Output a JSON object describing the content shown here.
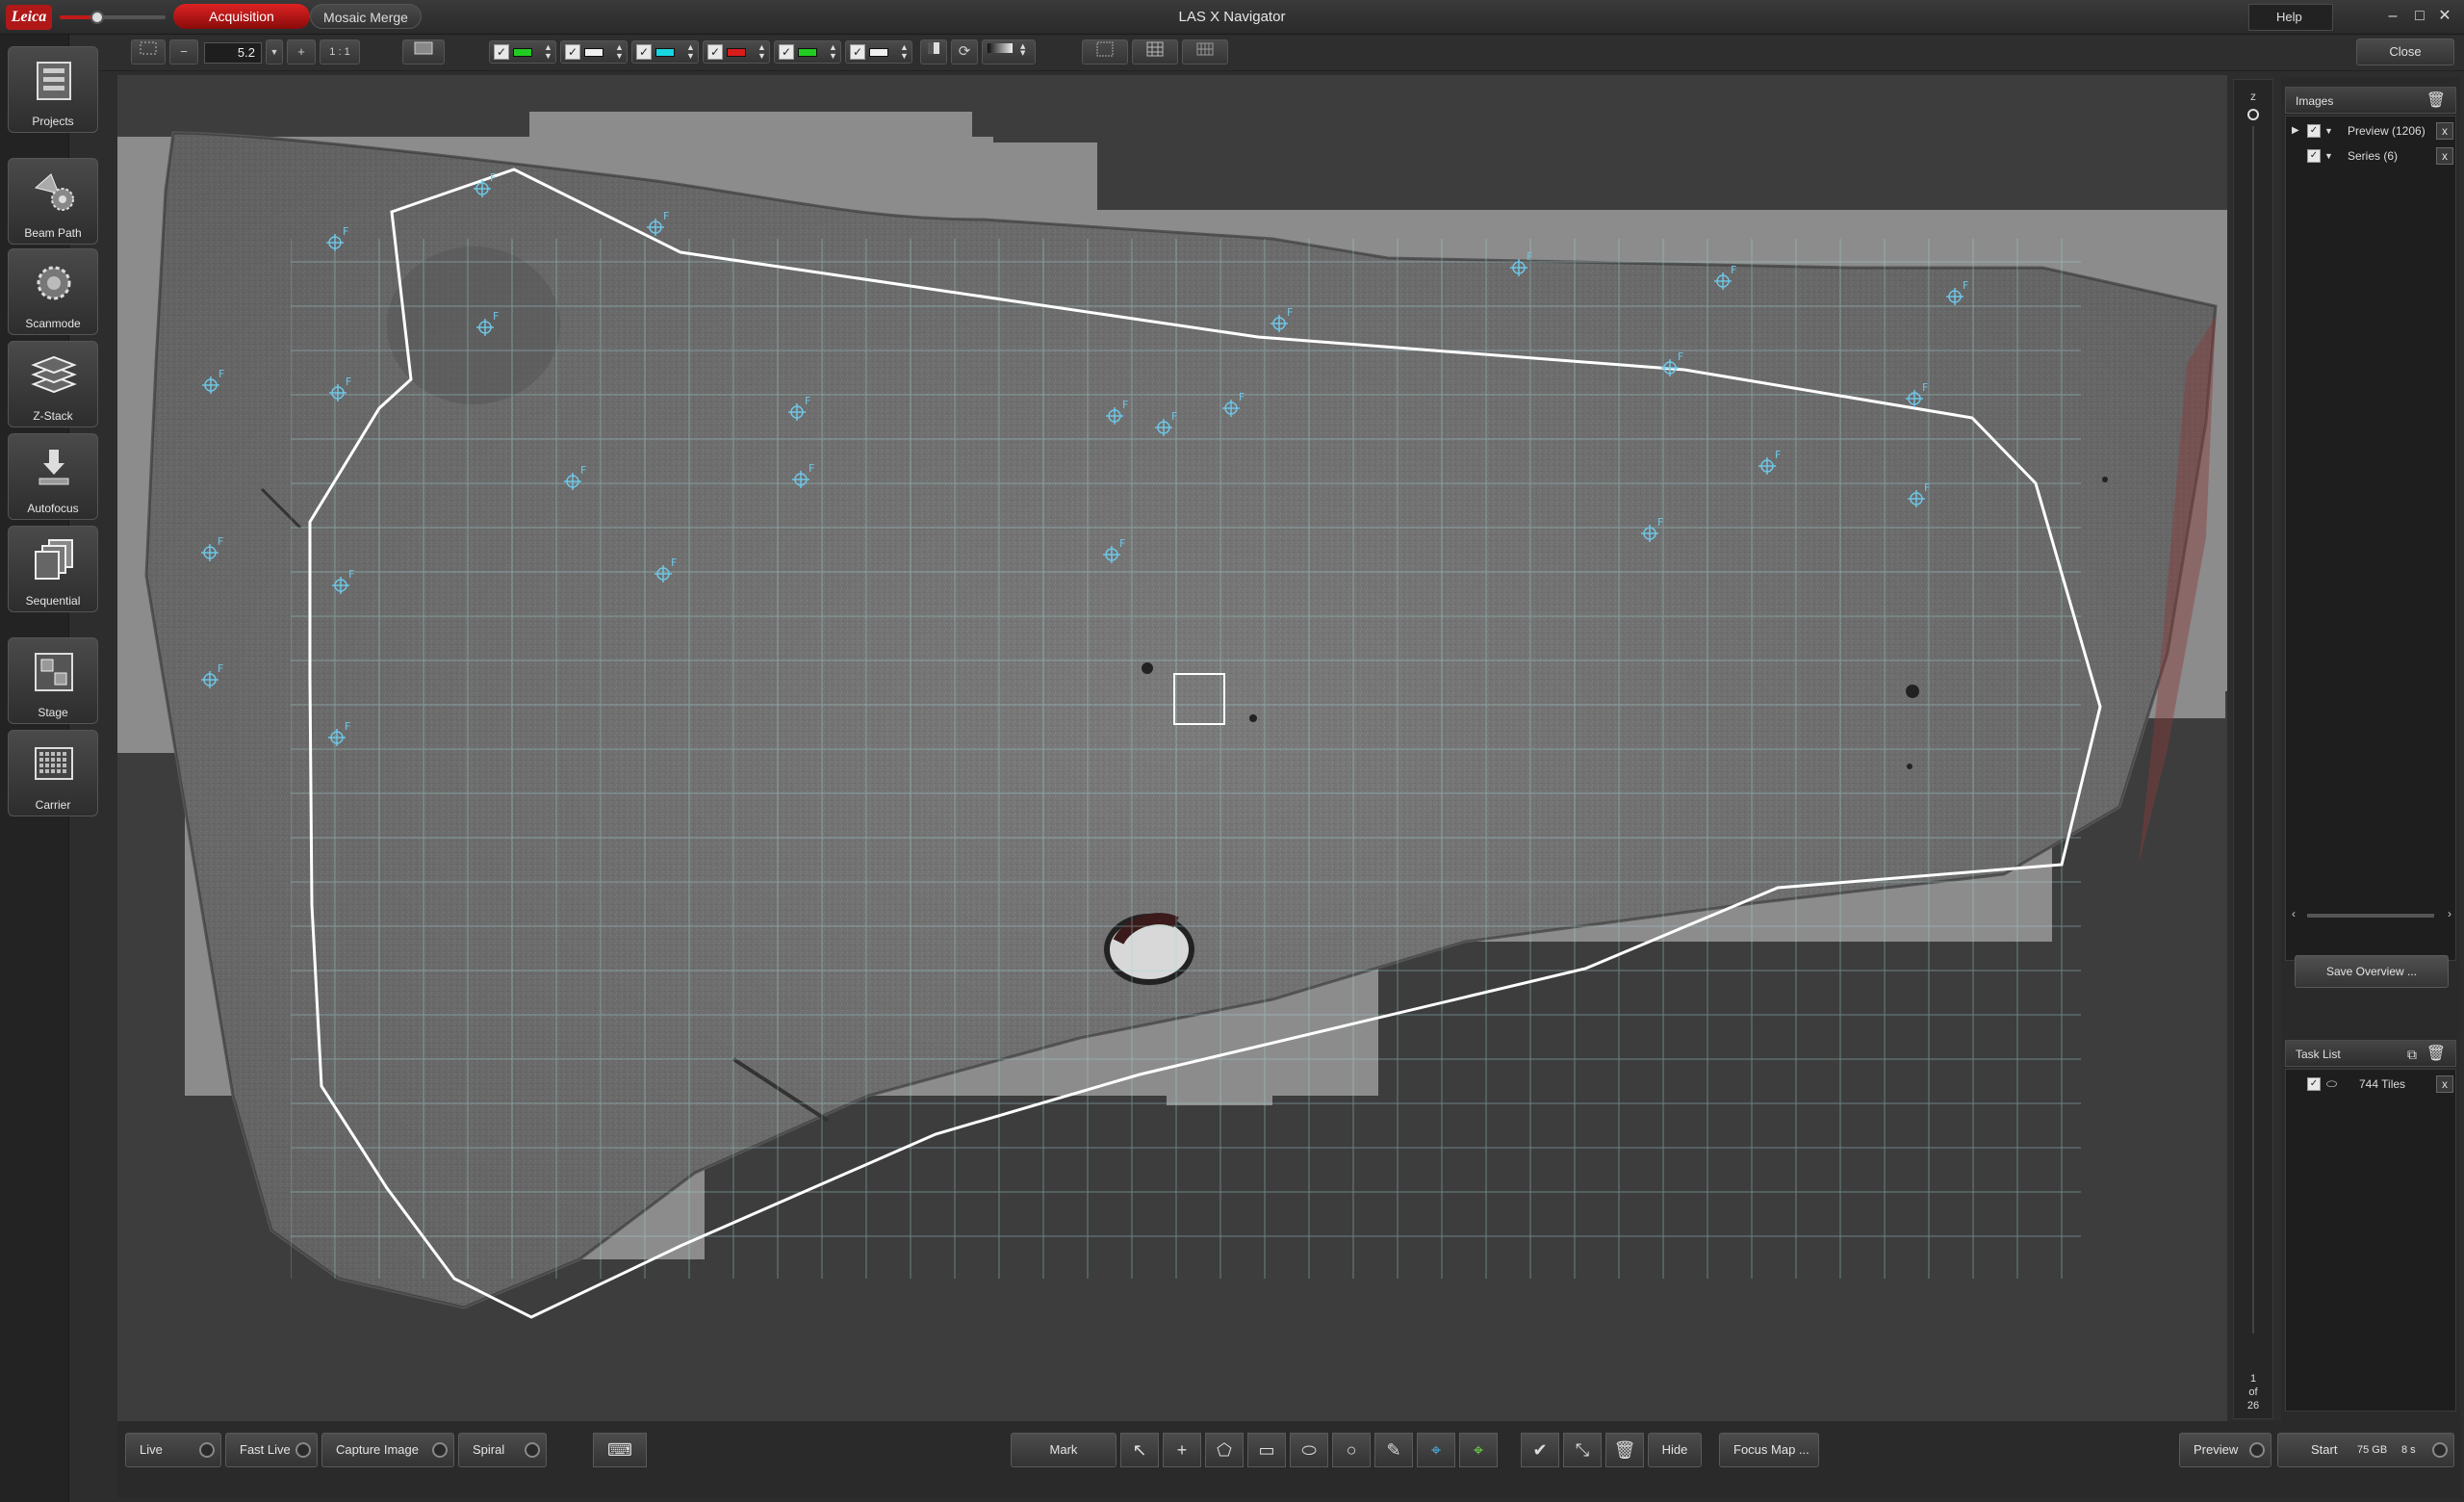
{
  "titlebar": {
    "logo": "Leica",
    "tab_active": "Acquisition",
    "tab_inactive": "Mosaic Merge",
    "title": "LAS X Navigator",
    "help": "Help"
  },
  "toolbar": {
    "zoom_value": "5.2",
    "one_to_one": "1 : 1",
    "minus": "−",
    "plus": "+",
    "close": "Close",
    "channel_colors": [
      "#22cc22",
      "#f0f0f0",
      "#19d6e0",
      "#d81c1c",
      "#22cc22",
      "#f0f0f0"
    ]
  },
  "sidebar": {
    "items": [
      {
        "label": "Projects",
        "icon": "projects-icon"
      },
      {
        "label": "Beam Path",
        "icon": "beam-path-icon"
      },
      {
        "label": "Scanmode",
        "icon": "scanmode-icon"
      },
      {
        "label": "Z-Stack",
        "icon": "zstack-icon"
      },
      {
        "label": "Autofocus",
        "icon": "autofocus-icon"
      },
      {
        "label": "Sequential",
        "icon": "sequential-icon"
      },
      {
        "label": "Stage",
        "icon": "stage-icon"
      },
      {
        "label": "Carrier",
        "icon": "carrier-icon"
      }
    ]
  },
  "zrail": {
    "label": "z",
    "page_current": "1",
    "page_of": "of",
    "page_total": "26"
  },
  "images_panel": {
    "title": "Images",
    "items": [
      {
        "label": "Preview (1206)"
      },
      {
        "label": "Series (6)"
      }
    ],
    "save_button": "Save Overview ..."
  },
  "task_panel": {
    "title": "Task List",
    "items": [
      {
        "label": "744 Tiles"
      }
    ]
  },
  "bottombar": {
    "live": "Live",
    "fast_live": "Fast Live",
    "capture_image": "Capture Image",
    "spiral": "Spiral",
    "mark": "Mark",
    "hide": "Hide",
    "focus_map": "Focus Map ...",
    "preview": "Preview",
    "start": "Start",
    "start_size": "75 GB",
    "start_time": "8 s"
  },
  "colors": {
    "accent_red": "#c8161b",
    "focus_marker": "#6ec6e6",
    "outline": "#ffffff"
  },
  "focus_marker_label": "F"
}
